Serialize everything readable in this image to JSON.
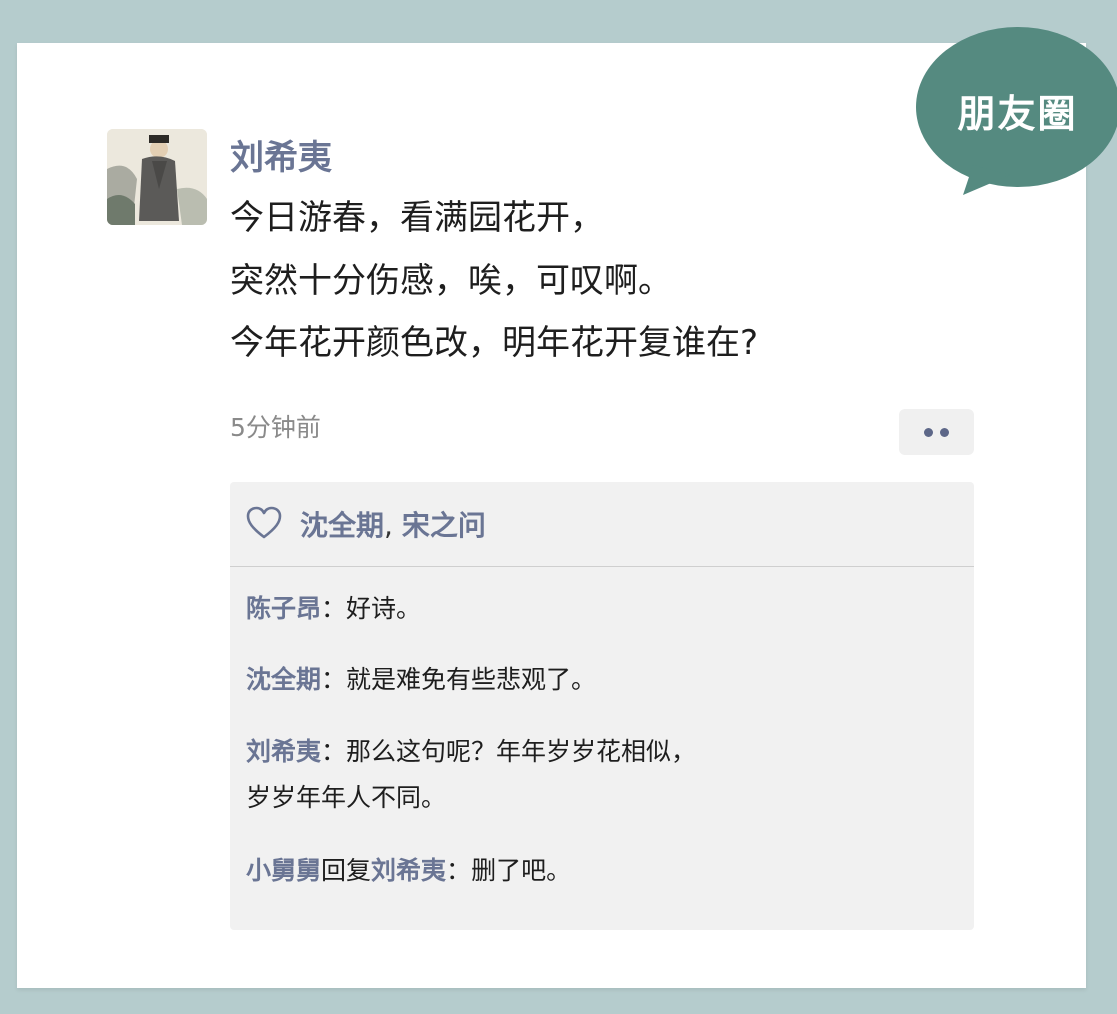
{
  "badge": {
    "label": "朋友圈"
  },
  "post": {
    "author": "刘希夷",
    "lines": [
      "今日游春，看满园花开，",
      "突然十分伤感，唉，可叹啊。",
      "今年花开颜色改，明年花开复谁在?"
    ],
    "time": "5分钟前"
  },
  "likes": {
    "names": [
      "沈全期",
      "宋之问"
    ],
    "separator": ","
  },
  "comments": [
    {
      "name": "陈子昂",
      "colon": "：",
      "text": "好诗。"
    },
    {
      "name": "沈全期",
      "colon": "：",
      "text": "就是难免有些悲观了。"
    },
    {
      "name": "刘希夷",
      "colon": "：",
      "text": "那么这句呢？年年岁岁花相似，",
      "text2": "岁岁年年人不同。"
    },
    {
      "name": "小舅舅",
      "reply_word": "回复",
      "reply_to": "刘希夷",
      "colon": "：",
      "text": "删了吧。"
    }
  ],
  "colors": {
    "background": "#b5cccd",
    "badge": "#558a80",
    "name_link": "#6a7594"
  }
}
